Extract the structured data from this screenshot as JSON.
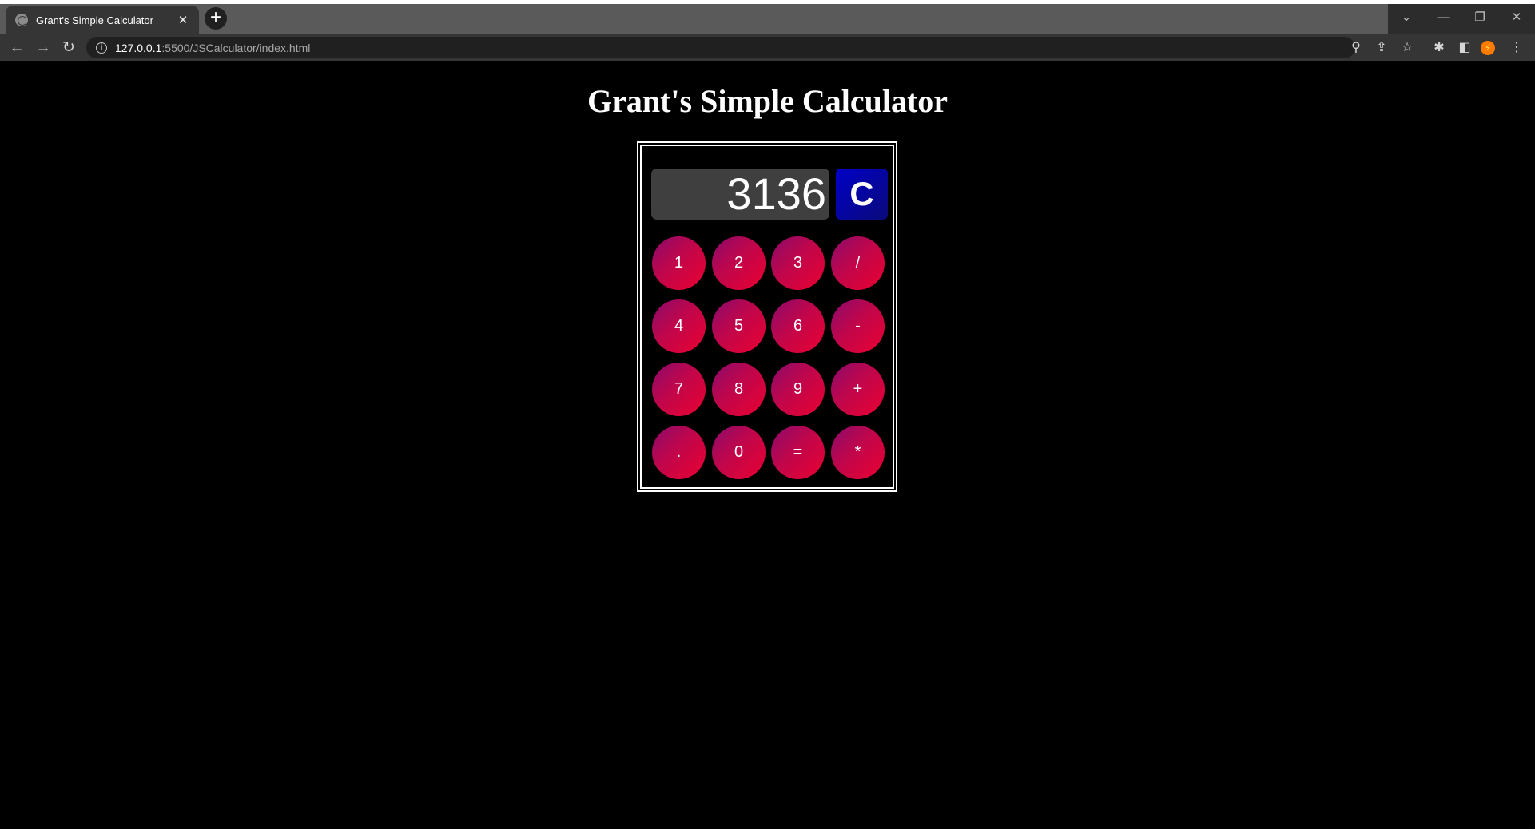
{
  "browser": {
    "tab_title": "Grant's Simple Calculator",
    "tab_close": "✕",
    "new_tab": "+",
    "url_host": "127.0.0.1",
    "url_path": ":5500/JSCalculator/index.html",
    "window_controls": {
      "tabsearch": "⌄",
      "minimize": "—",
      "restore": "❐",
      "close": "✕"
    },
    "nav": {
      "back": "←",
      "forward": "→",
      "reload": "↻"
    },
    "toolbar_icons": {
      "zoom": "⚲",
      "share": "⇪",
      "bookmark": "☆",
      "extensions": "✱",
      "sidepanel": "◧",
      "menu": "⋮",
      "ext_badge": "⚡"
    }
  },
  "page": {
    "title": "Grant's Simple Calculator"
  },
  "calculator": {
    "display_value": "3136",
    "clear_label": "C",
    "keys": [
      [
        "1",
        "2",
        "3",
        "/"
      ],
      [
        "4",
        "5",
        "6",
        "-"
      ],
      [
        "7",
        "8",
        "9",
        "+"
      ],
      [
        ".",
        "0",
        "=",
        "*"
      ]
    ]
  },
  "colors": {
    "page_background": "#000000",
    "display_background": "#3f3f3f",
    "clear_button": "#0000c8",
    "key_gradient_start": "#8a0a6c",
    "key_gradient_end": "#ea0030"
  }
}
